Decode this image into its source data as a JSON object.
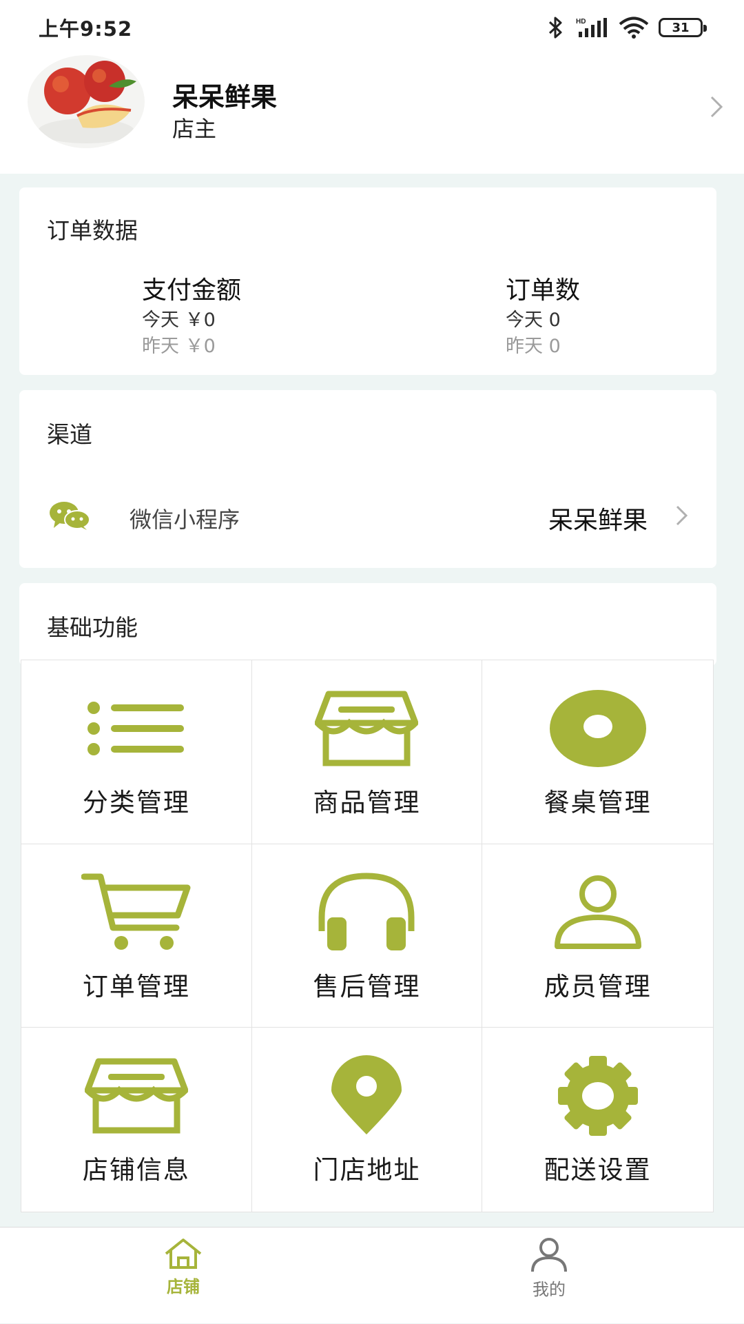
{
  "status_bar": {
    "time": "上午9:52",
    "battery": "31",
    "network": "HD"
  },
  "profile": {
    "name": "呆呆鲜果",
    "role": "店主"
  },
  "order_data": {
    "title": "订单数据",
    "payment": {
      "label": "支付金额",
      "today": "今天 ￥0",
      "yesterday": "昨天 ￥0"
    },
    "orders": {
      "label": "订单数",
      "today": "今天 0",
      "yesterday": "昨天 0"
    }
  },
  "channel": {
    "title": "渠道",
    "name": "微信小程序",
    "value": "呆呆鲜果"
  },
  "basic_functions": {
    "title": "基础功能",
    "items": [
      {
        "label": "分类管理",
        "icon": "list-icon"
      },
      {
        "label": "商品管理",
        "icon": "store-icon"
      },
      {
        "label": "餐桌管理",
        "icon": "table-icon"
      },
      {
        "label": "订单管理",
        "icon": "cart-icon"
      },
      {
        "label": "售后管理",
        "icon": "headphones-icon"
      },
      {
        "label": "成员管理",
        "icon": "user-icon"
      },
      {
        "label": "店铺信息",
        "icon": "store-icon"
      },
      {
        "label": "门店地址",
        "icon": "location-pin-icon"
      },
      {
        "label": "配送设置",
        "icon": "gear-icon"
      }
    ]
  },
  "tabbar": {
    "tabs": [
      {
        "label": "店铺",
        "active": true
      },
      {
        "label": "我的",
        "active": false
      }
    ]
  },
  "colors": {
    "accent": "#a6b43a",
    "background": "#eef5f4",
    "muted_text": "#9a9a9a",
    "tab_inactive": "#777777"
  }
}
